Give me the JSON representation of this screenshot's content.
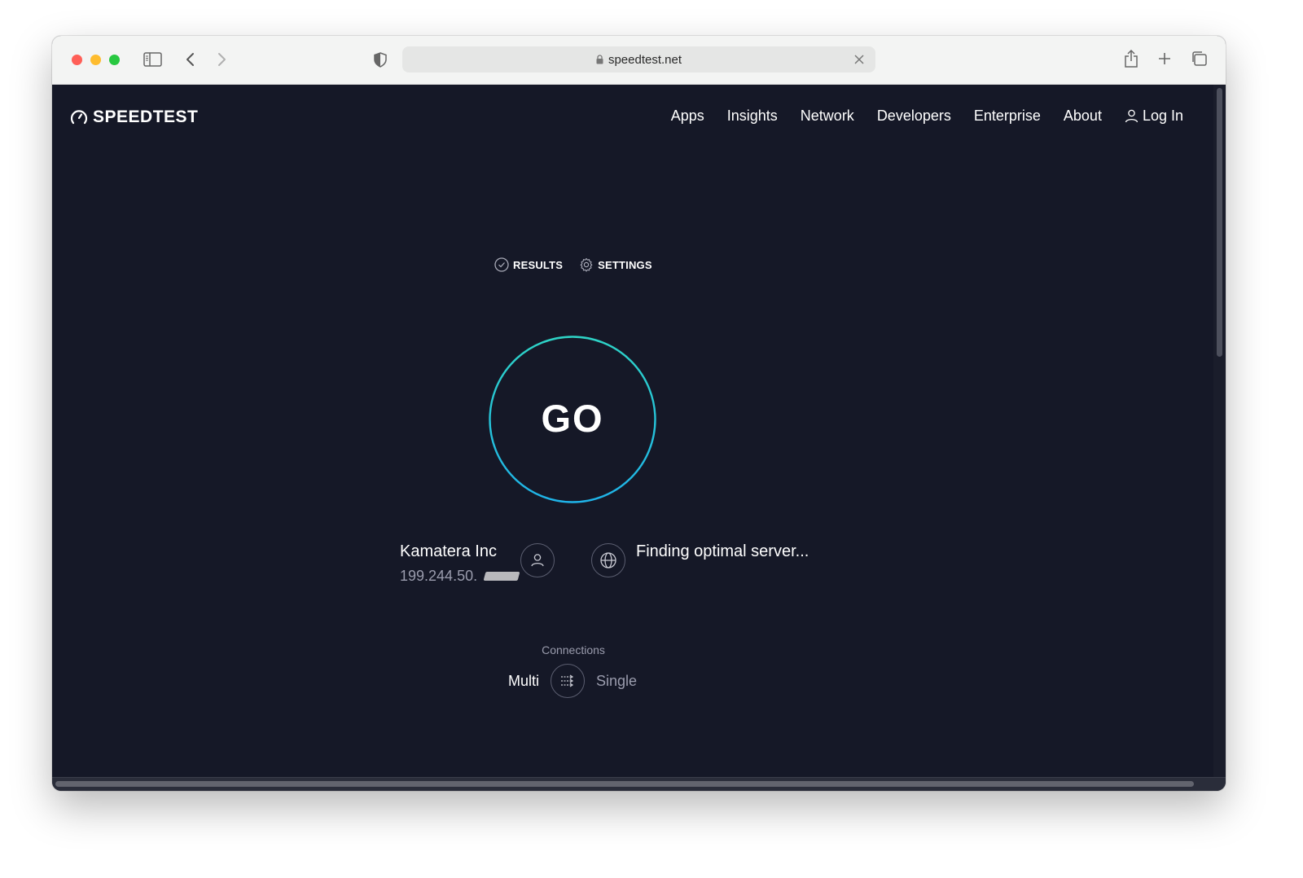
{
  "browser": {
    "url": "speedtest.net",
    "traffic_lights": {
      "close": "#ff5f57",
      "minimize": "#febc2e",
      "zoom": "#28c840"
    },
    "icons": [
      "sidebar-icon",
      "back-icon",
      "forward-icon",
      "shield-icon",
      "lock-icon",
      "close-icon",
      "share-icon",
      "new-tab-icon",
      "tabs-overview-icon"
    ]
  },
  "header": {
    "logo_text": "SPEEDTEST",
    "nav": [
      {
        "label": "Apps"
      },
      {
        "label": "Insights"
      },
      {
        "label": "Network"
      },
      {
        "label": "Developers"
      },
      {
        "label": "Enterprise"
      },
      {
        "label": "About"
      }
    ],
    "login_label": "Log In"
  },
  "tabs": [
    {
      "label": "RESULTS",
      "icon": "check-circle-icon"
    },
    {
      "label": "SETTINGS",
      "icon": "gear-icon"
    }
  ],
  "go_button": {
    "label": "GO",
    "ring_colors": [
      "#2ed3c6",
      "#1fb3e8"
    ]
  },
  "provider": {
    "name": "Kamatera Inc",
    "ip": "199.244.50.",
    "ip_redacted": true
  },
  "server": {
    "status": "Finding optimal server..."
  },
  "connections": {
    "label": "Connections",
    "options": [
      "Multi",
      "Single"
    ],
    "selected": "Multi"
  },
  "colors": {
    "page_bg": "#151827",
    "text": "#ffffff",
    "muted": "#9a9cad"
  }
}
